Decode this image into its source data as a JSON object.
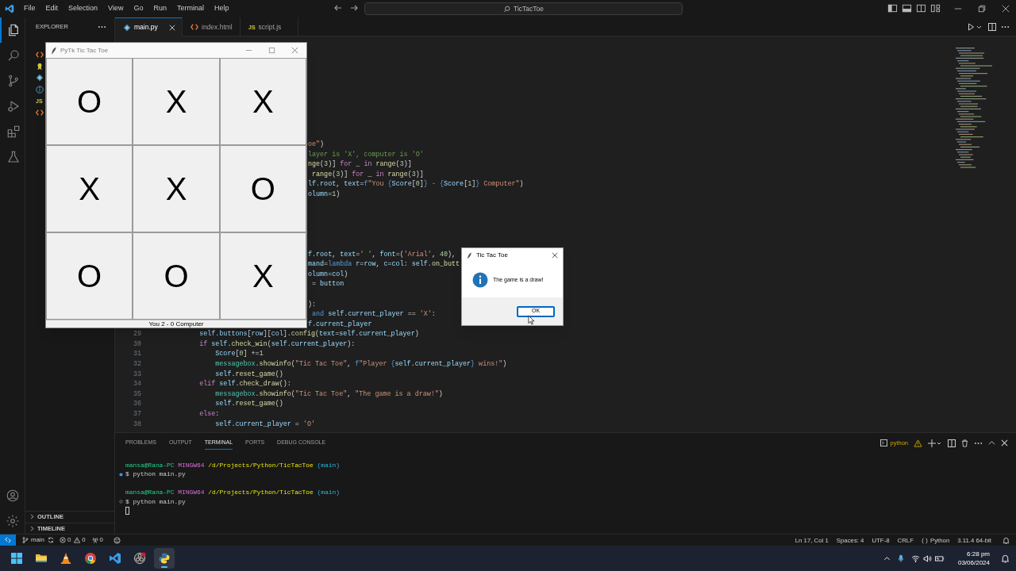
{
  "menu": [
    "File",
    "Edit",
    "Selection",
    "View",
    "Go",
    "Run",
    "Terminal",
    "Help"
  ],
  "command_center": {
    "text": "TicTacToe"
  },
  "activity_bar": [
    {
      "kind": "explorer",
      "selected": true
    },
    {
      "kind": "search",
      "selected": false
    },
    {
      "kind": "source-control",
      "selected": false
    },
    {
      "kind": "run",
      "selected": false
    },
    {
      "kind": "extensions",
      "selected": false
    },
    {
      "kind": "testing",
      "selected": false
    }
  ],
  "activity_bottom": [
    {
      "kind": "account"
    },
    {
      "kind": "settings"
    }
  ],
  "sidebar": {
    "title": "EXPLORER",
    "files": [
      {
        "kind": "html"
      },
      {
        "kind": "license"
      },
      {
        "kind": "python"
      },
      {
        "kind": "info"
      },
      {
        "kind": "js",
        "badge": "JS"
      },
      {
        "kind": "html"
      }
    ],
    "sections": [
      {
        "label": "OUTLINE",
        "expanded": false
      },
      {
        "label": "TIMELINE",
        "expanded": false
      }
    ]
  },
  "editor_tabs": [
    {
      "label": "main.py",
      "kind": "python",
      "selected": true
    },
    {
      "label": "index.html",
      "kind": "html",
      "selected": false
    },
    {
      "label": "script.js",
      "kind": "js",
      "badge": "JS",
      "selected": false
    }
  ],
  "code_lines": [
    {
      "kind": "fragment",
      "tokens": [
        {
          "kind": "str",
          "text": "oe\""
        },
        {
          "kind": "plain",
          "text": ")"
        }
      ]
    },
    {
      "kind": "fragment",
      "tokens": [
        {
          "kind": "comment",
          "text": "layer is 'X', computer is 'O'"
        }
      ]
    },
    {
      "kind": "fragment",
      "tokens": [
        {
          "kind": "fn",
          "text": "nge"
        },
        {
          "kind": "plain",
          "text": "("
        },
        {
          "kind": "num",
          "text": "3"
        },
        {
          "kind": "plain",
          "text": ")] "
        },
        {
          "kind": "kw",
          "text": "for"
        },
        {
          "kind": "plain",
          "text": " _ "
        },
        {
          "kind": "kw",
          "text": "in "
        },
        {
          "kind": "fn",
          "text": "range"
        },
        {
          "kind": "plain",
          "text": "("
        },
        {
          "kind": "num",
          "text": "3"
        },
        {
          "kind": "plain",
          "text": ")]"
        }
      ]
    },
    {
      "kind": "fragment",
      "tokens": [
        {
          "kind": "fn",
          "text": " range"
        },
        {
          "kind": "plain",
          "text": "("
        },
        {
          "kind": "num",
          "text": "3"
        },
        {
          "kind": "plain",
          "text": ")] "
        },
        {
          "kind": "kw",
          "text": "for"
        },
        {
          "kind": "plain",
          "text": " _ "
        },
        {
          "kind": "kw",
          "text": "in "
        },
        {
          "kind": "fn",
          "text": "range"
        },
        {
          "kind": "plain",
          "text": "("
        },
        {
          "kind": "num",
          "text": "3"
        },
        {
          "kind": "plain",
          "text": ")]"
        }
      ]
    },
    {
      "kind": "fragment",
      "tokens": [
        {
          "kind": "var",
          "text": "lf"
        },
        {
          "kind": "plain",
          "text": "."
        },
        {
          "kind": "var",
          "text": "root"
        },
        {
          "kind": "plain",
          "text": ", "
        },
        {
          "kind": "var",
          "text": "text"
        },
        {
          "kind": "plain",
          "text": "="
        },
        {
          "kind": "storage",
          "text": "f"
        },
        {
          "kind": "str",
          "text": "\"You "
        },
        {
          "kind": "storage",
          "text": "{"
        },
        {
          "kind": "var",
          "text": "Score"
        },
        {
          "kind": "plain",
          "text": "["
        },
        {
          "kind": "num",
          "text": "0"
        },
        {
          "kind": "plain",
          "text": "]"
        },
        {
          "kind": "storage",
          "text": "}"
        },
        {
          "kind": "str",
          "text": " - "
        },
        {
          "kind": "storage",
          "text": "{"
        },
        {
          "kind": "var",
          "text": "Score"
        },
        {
          "kind": "plain",
          "text": "["
        },
        {
          "kind": "num",
          "text": "1"
        },
        {
          "kind": "plain",
          "text": "]"
        },
        {
          "kind": "storage",
          "text": "}"
        },
        {
          "kind": "str",
          "text": " Computer\""
        },
        {
          "kind": "plain",
          "text": ")"
        }
      ]
    },
    {
      "kind": "fragment",
      "tokens": [
        {
          "kind": "var",
          "text": "olumn"
        },
        {
          "kind": "plain",
          "text": "="
        },
        {
          "kind": "num",
          "text": "1"
        },
        {
          "kind": "plain",
          "text": ")"
        }
      ]
    },
    {
      "kind": "blank"
    },
    {
      "kind": "blank"
    },
    {
      "kind": "blank"
    },
    {
      "kind": "blank"
    },
    {
      "kind": "blank"
    },
    {
      "kind": "fragment",
      "tokens": [
        {
          "kind": "var",
          "text": "f"
        },
        {
          "kind": "plain",
          "text": "."
        },
        {
          "kind": "var",
          "text": "root"
        },
        {
          "kind": "plain",
          "text": ", "
        },
        {
          "kind": "var",
          "text": "text"
        },
        {
          "kind": "plain",
          "text": "="
        },
        {
          "kind": "str",
          "text": "' '"
        },
        {
          "kind": "plain",
          "text": ", "
        },
        {
          "kind": "var",
          "text": "font"
        },
        {
          "kind": "plain",
          "text": "=("
        },
        {
          "kind": "str",
          "text": "'Arial'"
        },
        {
          "kind": "plain",
          "text": ", "
        },
        {
          "kind": "num",
          "text": "40"
        },
        {
          "kind": "plain",
          "text": "),"
        }
      ]
    },
    {
      "kind": "fragment",
      "tokens": [
        {
          "kind": "var",
          "text": "mand"
        },
        {
          "kind": "plain",
          "text": "="
        },
        {
          "kind": "storage",
          "text": "lambda "
        },
        {
          "kind": "var",
          "text": "r"
        },
        {
          "kind": "plain",
          "text": "="
        },
        {
          "kind": "var",
          "text": "row"
        },
        {
          "kind": "plain",
          "text": ", "
        },
        {
          "kind": "var",
          "text": "c"
        },
        {
          "kind": "plain",
          "text": "="
        },
        {
          "kind": "var",
          "text": "col"
        },
        {
          "kind": "plain",
          "text": ": "
        },
        {
          "kind": "var",
          "text": "self"
        },
        {
          "kind": "plain",
          "text": "."
        },
        {
          "kind": "fn",
          "text": "on_butt"
        }
      ]
    },
    {
      "kind": "fragment",
      "tokens": [
        {
          "kind": "var",
          "text": "olumn"
        },
        {
          "kind": "plain",
          "text": "="
        },
        {
          "kind": "var",
          "text": "col"
        },
        {
          "kind": "plain",
          "text": ")"
        }
      ]
    },
    {
      "kind": "fragment",
      "tokens": [
        {
          "kind": "plain",
          "text": " = "
        },
        {
          "kind": "var",
          "text": "button"
        }
      ]
    },
    {
      "kind": "blank"
    },
    {
      "kind": "fragment",
      "tokens": [
        {
          "kind": "plain",
          "text": "):"
        }
      ]
    },
    {
      "kind": "fragment",
      "tokens": [
        {
          "kind": "storage",
          "text": " and "
        },
        {
          "kind": "var",
          "text": "self"
        },
        {
          "kind": "plain",
          "text": "."
        },
        {
          "kind": "var",
          "text": "current_player"
        },
        {
          "kind": "plain",
          "text": " == "
        },
        {
          "kind": "str",
          "text": "'X'"
        },
        {
          "kind": "plain",
          "text": ":"
        }
      ]
    },
    {
      "kind": "fragment",
      "tokens": [
        {
          "kind": "var",
          "text": "f"
        },
        {
          "kind": "plain",
          "text": "."
        },
        {
          "kind": "var",
          "text": "current_player"
        }
      ]
    },
    {
      "kind": "full",
      "number": "29",
      "tokens": [
        {
          "kind": "var",
          "text": "        self"
        },
        {
          "kind": "plain",
          "text": "."
        },
        {
          "kind": "var",
          "text": "buttons"
        },
        {
          "kind": "plain",
          "text": "["
        },
        {
          "kind": "var",
          "text": "row"
        },
        {
          "kind": "plain",
          "text": "]["
        },
        {
          "kind": "var",
          "text": "col"
        },
        {
          "kind": "plain",
          "text": "]."
        },
        {
          "kind": "fn",
          "text": "config"
        },
        {
          "kind": "plain",
          "text": "("
        },
        {
          "kind": "var",
          "text": "text"
        },
        {
          "kind": "plain",
          "text": "="
        },
        {
          "kind": "var",
          "text": "self"
        },
        {
          "kind": "plain",
          "text": "."
        },
        {
          "kind": "var",
          "text": "current_player"
        },
        {
          "kind": "plain",
          "text": ")"
        }
      ]
    },
    {
      "kind": "full",
      "number": "30",
      "tokens": [
        {
          "kind": "kw",
          "text": "        if "
        },
        {
          "kind": "var",
          "text": "self"
        },
        {
          "kind": "plain",
          "text": "."
        },
        {
          "kind": "fn",
          "text": "check_win"
        },
        {
          "kind": "plain",
          "text": "("
        },
        {
          "kind": "var",
          "text": "self"
        },
        {
          "kind": "plain",
          "text": "."
        },
        {
          "kind": "var",
          "text": "current_player"
        },
        {
          "kind": "plain",
          "text": "):"
        }
      ]
    },
    {
      "kind": "full",
      "number": "31",
      "tokens": [
        {
          "kind": "var",
          "text": "            Score"
        },
        {
          "kind": "plain",
          "text": "["
        },
        {
          "kind": "num",
          "text": "0"
        },
        {
          "kind": "plain",
          "text": "] +="
        },
        {
          "kind": "num",
          "text": "1"
        }
      ]
    },
    {
      "kind": "full",
      "number": "32",
      "tokens": [
        {
          "kind": "cls",
          "text": "            messagebox"
        },
        {
          "kind": "plain",
          "text": "."
        },
        {
          "kind": "fn",
          "text": "showinfo"
        },
        {
          "kind": "plain",
          "text": "("
        },
        {
          "kind": "str",
          "text": "\"Tic Tac Toe\""
        },
        {
          "kind": "plain",
          "text": ", "
        },
        {
          "kind": "storage",
          "text": "f"
        },
        {
          "kind": "str",
          "text": "\"Player "
        },
        {
          "kind": "storage",
          "text": "{"
        },
        {
          "kind": "var",
          "text": "self"
        },
        {
          "kind": "plain",
          "text": "."
        },
        {
          "kind": "var",
          "text": "current_player"
        },
        {
          "kind": "storage",
          "text": "}"
        },
        {
          "kind": "str",
          "text": " wins!\""
        },
        {
          "kind": "plain",
          "text": ")"
        }
      ]
    },
    {
      "kind": "full",
      "number": "33",
      "tokens": [
        {
          "kind": "var",
          "text": "            self"
        },
        {
          "kind": "plain",
          "text": "."
        },
        {
          "kind": "fn",
          "text": "reset_game"
        },
        {
          "kind": "plain",
          "text": "()"
        }
      ]
    },
    {
      "kind": "full",
      "number": "34",
      "tokens": [
        {
          "kind": "kw",
          "text": "        elif "
        },
        {
          "kind": "var",
          "text": "self"
        },
        {
          "kind": "plain",
          "text": "."
        },
        {
          "kind": "fn",
          "text": "check_draw"
        },
        {
          "kind": "plain",
          "text": "():"
        }
      ]
    },
    {
      "kind": "full",
      "number": "35",
      "tokens": [
        {
          "kind": "cls",
          "text": "            messagebox"
        },
        {
          "kind": "plain",
          "text": "."
        },
        {
          "kind": "fn",
          "text": "showinfo"
        },
        {
          "kind": "plain",
          "text": "("
        },
        {
          "kind": "str",
          "text": "\"Tic Tac Toe\""
        },
        {
          "kind": "plain",
          "text": ", "
        },
        {
          "kind": "str",
          "text": "\"The game is a draw!\""
        },
        {
          "kind": "plain",
          "text": ")"
        }
      ]
    },
    {
      "kind": "full",
      "number": "36",
      "tokens": [
        {
          "kind": "var",
          "text": "            self"
        },
        {
          "kind": "plain",
          "text": "."
        },
        {
          "kind": "fn",
          "text": "reset_game"
        },
        {
          "kind": "plain",
          "text": "()"
        }
      ]
    },
    {
      "kind": "full",
      "number": "37",
      "tokens": [
        {
          "kind": "kw",
          "text": "        else"
        },
        {
          "kind": "plain",
          "text": ":"
        }
      ]
    },
    {
      "kind": "full",
      "number": "38",
      "tokens": [
        {
          "kind": "var",
          "text": "            self"
        },
        {
          "kind": "plain",
          "text": "."
        },
        {
          "kind": "var",
          "text": "current_player"
        },
        {
          "kind": "plain",
          "text": " = "
        },
        {
          "kind": "str",
          "text": "'O'"
        }
      ]
    }
  ],
  "panel": {
    "tabs": [
      {
        "label": "PROBLEMS",
        "selected": false
      },
      {
        "label": "OUTPUT",
        "selected": false
      },
      {
        "label": "TERMINAL",
        "selected": true
      },
      {
        "label": "PORTS",
        "selected": false
      },
      {
        "label": "DEBUG CONSOLE",
        "selected": false
      }
    ],
    "shell": "python",
    "lines": [
      {
        "kind": "prompt",
        "user": "mansa@Rana-PC",
        "host": "MINGW64",
        "path": "/d/Projects/Python/TicTacToe",
        "branch": "(main)"
      },
      {
        "kind": "command",
        "text": "$ python main.py",
        "finished": true
      },
      {
        "kind": "blank"
      },
      {
        "kind": "prompt",
        "user": "mansa@Rana-PC",
        "host": "MINGW64",
        "path": "/d/Projects/Python/TicTacToe",
        "branch": "(main)"
      },
      {
        "kind": "command",
        "text": "$ python main.py",
        "finished": false
      },
      {
        "kind": "cursor"
      }
    ]
  },
  "status_bar": {
    "branch": "main",
    "errors": "0",
    "warnings": "0",
    "ports": "0",
    "right": [
      {
        "kind": "text",
        "text": "Ln 17, Col 1"
      },
      {
        "kind": "text",
        "text": "Spaces: 4"
      },
      {
        "kind": "text",
        "text": "UTF-8"
      },
      {
        "kind": "text",
        "text": "CRLF"
      },
      {
        "kind": "language",
        "text": "Python"
      },
      {
        "kind": "text",
        "text": "3.11.4 64-bit"
      }
    ]
  },
  "taskbar": {
    "apps": [
      {
        "kind": "start",
        "selected": false
      },
      {
        "kind": "folder",
        "selected": false
      },
      {
        "kind": "cone",
        "selected": false
      },
      {
        "kind": "browser",
        "selected": false
      },
      {
        "kind": "editor",
        "selected": false
      },
      {
        "kind": "recorder",
        "selected": false
      },
      {
        "kind": "python",
        "selected": true
      }
    ],
    "time": "6:28 pm",
    "date": "03/06/2024"
  },
  "game_window": {
    "title": "PyTk Tic Tac Toe",
    "cells": [
      "O",
      "X",
      "X",
      "X",
      "X",
      "O",
      "O",
      "O",
      "X"
    ],
    "score": "You 2 - 0 Computer"
  },
  "dialog": {
    "title": "Tic Tac Toe",
    "message": "The game is a draw!",
    "button": "OK"
  }
}
